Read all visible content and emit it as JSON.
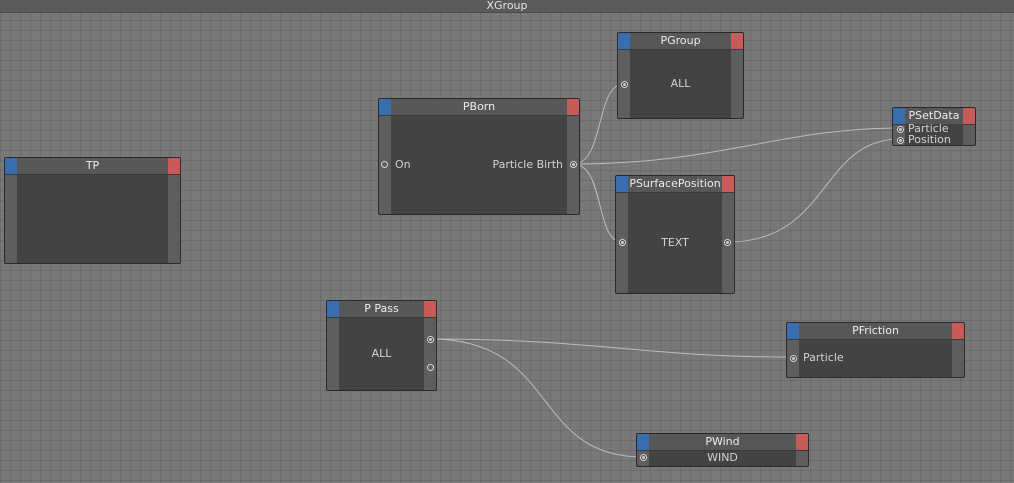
{
  "window": {
    "title": "XGroup"
  },
  "nodes": {
    "tp": {
      "title": "TP"
    },
    "pborn": {
      "title": "PBorn",
      "port_in": "On",
      "port_out": "Particle Birth"
    },
    "pgroup": {
      "title": "PGroup",
      "value": "ALL"
    },
    "psetdata": {
      "title": "PSetData",
      "port1": "Particle",
      "port2": "Position"
    },
    "psurface": {
      "title": "PSurfacePosition",
      "value": "TEXT"
    },
    "ppass": {
      "title": "P Pass",
      "value": "ALL"
    },
    "pfriction": {
      "title": "PFriction",
      "port_in": "Particle"
    },
    "pwind": {
      "title": "PWind",
      "value": "WIND"
    }
  },
  "colors": {
    "header_left_cap": "#3a6db0",
    "header_right_cap": "#c95a5a",
    "wire": "#c8c8c8"
  }
}
